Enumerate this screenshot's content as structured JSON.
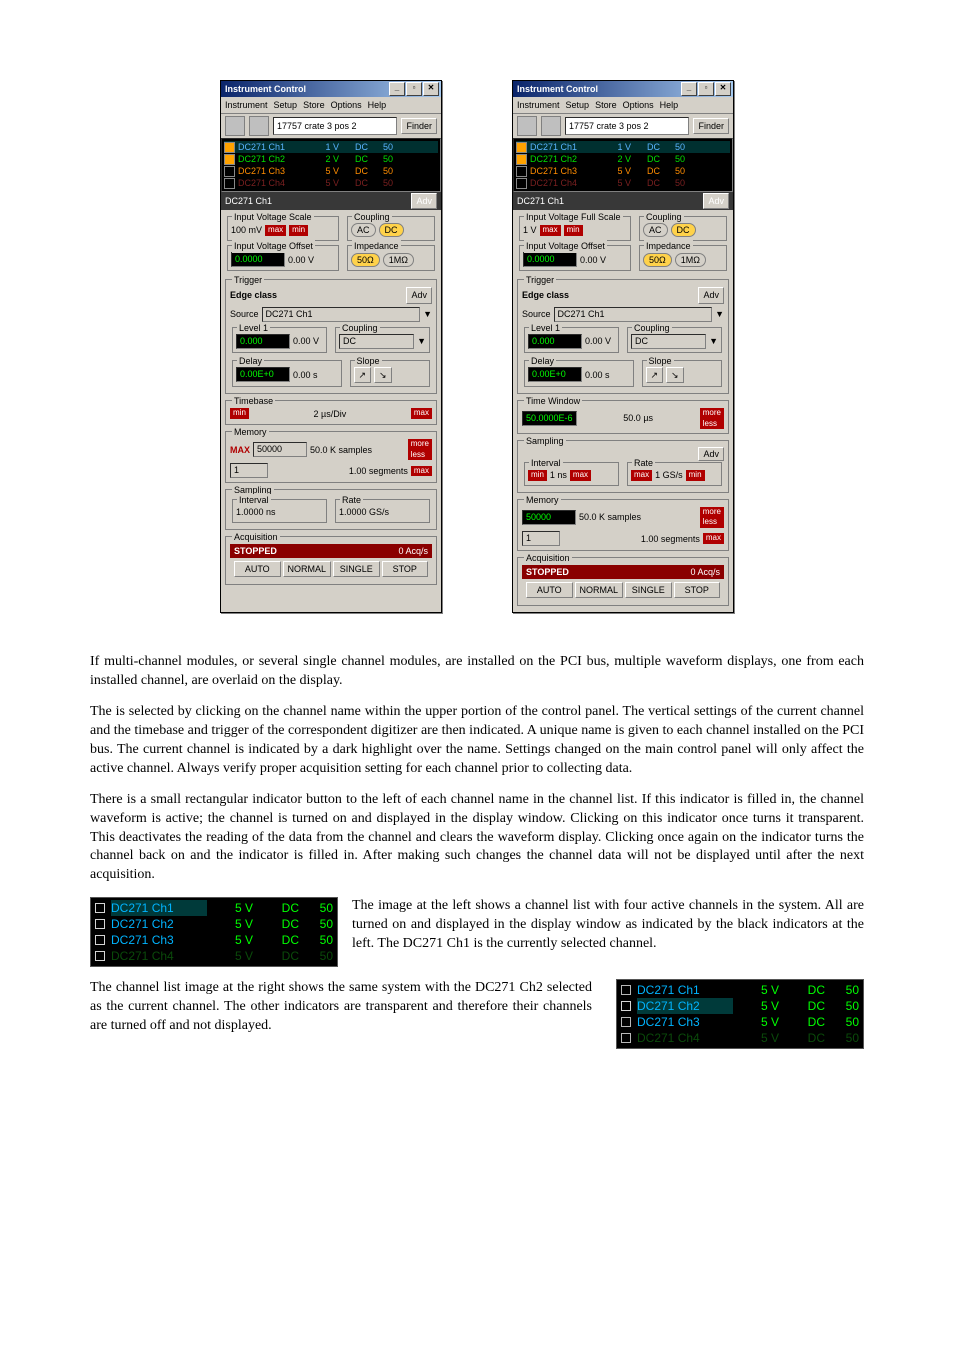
{
  "panels": {
    "title": "Instrument Control",
    "menu": [
      "Instrument",
      "Setup",
      "Store",
      "Options",
      "Help"
    ],
    "location": "17757 crate 3 pos 2",
    "finder": "Finder",
    "channels": [
      {
        "name": "DC271 Ch1",
        "v": "1 V",
        "cpl": "DC",
        "imp": "50",
        "on": true,
        "color": "#5ab4ff"
      },
      {
        "name": "DC271 Ch2",
        "v": "2 V",
        "cpl": "DC",
        "imp": "50",
        "on": true,
        "color": "#00e000"
      },
      {
        "name": "DC271 Ch3",
        "v": "5 V",
        "cpl": "DC",
        "imp": "50",
        "on": false,
        "color": "#ff8c00"
      },
      {
        "name": "DC271 Ch4",
        "v": "5 V",
        "cpl": "DC",
        "imp": "50",
        "on": false,
        "color": "#ff2a2a"
      }
    ],
    "selected_channel": "DC271 Ch1",
    "adv": "Adv",
    "coupling": {
      "title": "Coupling",
      "ac": "AC",
      "dc": "DC"
    },
    "impedance": {
      "title": "Impedance",
      "fifty": "50Ω",
      "meg": "1MΩ"
    },
    "offset": {
      "title": "Input Voltage Offset",
      "raw": "0.0000",
      "val": "0.00 V"
    },
    "trigger": {
      "title": "Trigger",
      "adv": "Adv",
      "class": "Edge class",
      "source_lbl": "Source",
      "source": "DC271 Ch1",
      "level_title": "Level 1",
      "level_raw": "0.000",
      "level_val": "0.00 V",
      "coupling_title": "Coupling",
      "coupling_val": "DC",
      "delay_title": "Delay",
      "delay_raw": "0.00E+0",
      "delay_val": "0.00 s",
      "slope_title": "Slope"
    },
    "left": {
      "scale": {
        "title": "Input Voltage Scale",
        "value": "100 mV"
      },
      "timebase": {
        "title": "Timebase",
        "value": "2 µs/Div"
      },
      "memory": {
        "title": "Memory",
        "max": "MAX",
        "mem_raw": "50000",
        "mem_val": "50.0 K  samples",
        "seg_raw": "1",
        "seg_val": "1.00  segments"
      },
      "sampling": {
        "title": "Sampling",
        "interval_title": "Interval",
        "interval": "1.0000 ns",
        "rate_title": "Rate",
        "rate": "1.0000 GS/s"
      }
    },
    "right": {
      "scale": {
        "title": "Input Voltage Full Scale",
        "value": "1 V"
      },
      "timewindow": {
        "title": "Time Window",
        "raw": "50.0000E-6",
        "val": "50.0 µs"
      },
      "sampling": {
        "title": "Sampling",
        "adv": "Adv",
        "interval_title": "Interval",
        "interval": "1 ns",
        "rate_title": "Rate",
        "rate": "1 GS/s"
      },
      "memory": {
        "title": "Memory",
        "mem_raw": "50000",
        "mem_val": "50.0 K  samples",
        "seg_raw": "1",
        "seg_val": "1.00  segments"
      }
    },
    "acq": {
      "title": "Acquisition",
      "status": "STOPPED",
      "rate": "0 Acq/s",
      "buttons": [
        "AUTO",
        "NORMAL",
        "SINGLE",
        "STOP"
      ]
    },
    "chips": {
      "max": "max",
      "min": "min",
      "more": "more",
      "less": "less"
    }
  },
  "paragraphs": {
    "p1": "If multi-channel modules, or several single channel modules, are installed on the PCI bus, multiple waveform displays, one from each installed channel, are overlaid on the display.",
    "p2a": "The ",
    "p2b": " is selected by clicking on the channel name within the upper portion of the control panel. The vertical settings of the current channel and the timebase and trigger of the correspondent digitizer are then indicated. A unique name is given to each channel installed on the PCI bus. The current channel is indicated by a dark highlight over the name. Settings changed on the main control panel will only affect the active channel. Always verify proper acquisition setting for each channel prior to collecting data.",
    "p3": "There is a small rectangular indicator button to the left of each channel name in the channel list. If this indicator is filled in, the channel waveform is active; the channel is turned on and displayed in the display window. Clicking on this indicator once turns it transparent. This deactivates the reading of the data from the channel and clears the waveform display. Clicking once again on the indicator turns the channel back on and the indicator is filled in. After making such changes the channel data will not be displayed until after the next acquisition.",
    "p4": "The image at the left shows a channel list with four active channels in the system. All are turned on and displayed in the display window as indicated by the black indicators at the left. The DC271 Ch1 is the currently selected channel.",
    "p5": "The channel list image at the right shows the same system with the DC271 Ch2 selected as the current channel. The other indicators are transparent and therefore their channels are turned off and not displayed."
  },
  "chlist_left": [
    {
      "on": true,
      "sel": true,
      "dim": false,
      "name": "DC271 Ch1",
      "v": "5 V",
      "cpl": "DC",
      "imp": "50"
    },
    {
      "on": true,
      "sel": false,
      "dim": false,
      "name": "DC271 Ch2",
      "v": "5 V",
      "cpl": "DC",
      "imp": "50"
    },
    {
      "on": true,
      "sel": false,
      "dim": false,
      "name": "DC271 Ch3",
      "v": "5 V",
      "cpl": "DC",
      "imp": "50"
    },
    {
      "on": true,
      "sel": false,
      "dim": true,
      "name": "DC271 Ch4",
      "v": "5 V",
      "cpl": "DC",
      "imp": "50"
    }
  ],
  "chlist_right": [
    {
      "on": false,
      "sel": false,
      "dim": false,
      "name": "DC271 Ch1",
      "v": "5 V",
      "cpl": "DC",
      "imp": "50"
    },
    {
      "on": true,
      "sel": true,
      "dim": false,
      "name": "DC271 Ch2",
      "v": "5 V",
      "cpl": "DC",
      "imp": "50"
    },
    {
      "on": false,
      "sel": false,
      "dim": false,
      "name": "DC271 Ch3",
      "v": "5 V",
      "cpl": "DC",
      "imp": "50"
    },
    {
      "on": false,
      "sel": false,
      "dim": true,
      "name": "DC271 Ch4",
      "v": "5 V",
      "cpl": "DC",
      "imp": "50"
    }
  ]
}
